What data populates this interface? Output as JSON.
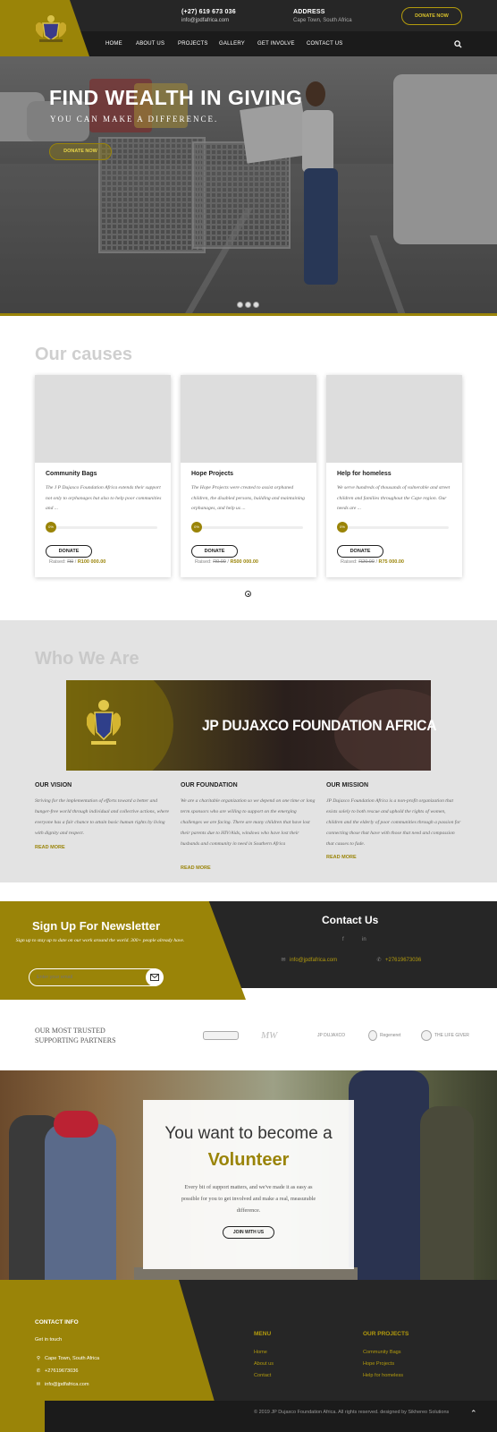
{
  "header": {
    "phone": "(+27) 619 673 036",
    "email": "info@jpdfafrica.com",
    "address_label": "ADDRESS",
    "address": "Cape Town, South Africa",
    "donate_label": "DONATE NOW",
    "nav": [
      "HOME",
      "ABOUT US",
      "PROJECTS",
      "GALLERY",
      "GET INVOLVE",
      "CONTACT US"
    ]
  },
  "hero": {
    "title": "FIND WEALTH IN GIVING",
    "subtitle": "YOU CAN MAKE A DIFFERENCE.",
    "button": "DONATE NOW"
  },
  "causes": {
    "title": "Our causes",
    "cards": [
      {
        "title": "Community Bags",
        "text": "The J P Dujaxco Foundation Africa extends their support not only to orphanages but also to help poor communities and ...",
        "progress": 0,
        "progress_label": "0%",
        "button": "DONATE",
        "raised_label": "Raised:",
        "raised": "R0",
        "goal": "R100 000.00"
      },
      {
        "title": "Hope Projects",
        "text": "The Hope Projects were created to assist orphaned children, the disabled persons, building and maintaining orphanages, and help us ...",
        "progress": 0,
        "progress_label": "0%",
        "button": "DONATE",
        "raised_label": "Raised:",
        "raised": "R0.00",
        "goal": "R500 000.00"
      },
      {
        "title": "Help for homeless",
        "text": "We serve hundreds of thousands of vulnerable and street children and families throughout the Cape region. Our needs are ...",
        "progress": 0,
        "progress_label": "0%",
        "button": "DONATE",
        "raised_label": "Raised:",
        "raised": "R20.00",
        "goal": "R75 000.00"
      }
    ]
  },
  "who": {
    "title": "Who We Are",
    "banner_text": "JP DUJAXCO FOUNDATION AFRICA",
    "columns": [
      {
        "heading": "OUR VISION",
        "text": "Striving for the implementation of efforts toward a better and hunger-free world through individual and collective actions, where everyone has a fair chance to attain basic human rights by living with dignity and respect.",
        "link": "READ MORE"
      },
      {
        "heading": "OUR FOUNDATION",
        "text": "We are a charitable organization so we depend on one time or long term sponsors who are willing to support on the emerging challenges we are facing. There are many children that have lost their parents due to HIV/Aids, windows who have lost their husbands and community in need in Southern Africa",
        "link": "READ MORE"
      },
      {
        "heading": "OUR MISSION",
        "text": "JP Dujaxco Foundation Africa is a non-profit organization that exists solely to both rescue and uphold the rights of women, children and the elderly of poor communities through a passion for connecting those that have with those that need and compassion that causes to fade.",
        "link": "READ MORE"
      }
    ]
  },
  "newsletter": {
    "title": "Sign Up For Newsletter",
    "text": "Sign up to stay up to date on our work around the world. 300+ people already have.",
    "placeholder": "Enter your email"
  },
  "contact": {
    "title": "Contact Us",
    "email": "info@jpdfafrica.com",
    "phone": "+27619673036"
  },
  "partners": {
    "heading_line1": "OUR MOST TRUSTED",
    "heading_line2": "SUPPORTING PARTNERS",
    "logos": [
      "",
      "MW",
      "JP DUJAXCO",
      "Regeneret",
      "THE LIFE GIVER"
    ]
  },
  "volunteer": {
    "line1": "You want to become a",
    "line2": "Volunteer",
    "text": "Every bit of support matters, and we've made it as easy as possible for you to get involved and make a real, measurable difference.",
    "button": "JOIN WITH US"
  },
  "footer": {
    "contact_heading": "CONTACT INFO",
    "get_in_touch": "Get in touch",
    "address": "Cape Town, South Africa",
    "phone": "+27619673036",
    "email": "info@jpdfafrica.com",
    "menu_heading": "MENU",
    "menu": [
      "Home",
      "About us",
      "Contact"
    ],
    "projects_heading": "OUR PROJECTS",
    "projects": [
      "Community Bags",
      "Hope Projects",
      "Help for homeless"
    ],
    "copyright": "© 2019 JP Dujaxco Foundation Africa. All rights reserved. designed by Sikhereo Solutions"
  },
  "colors": {
    "accent": "#9a8408",
    "dark": "#262626"
  }
}
